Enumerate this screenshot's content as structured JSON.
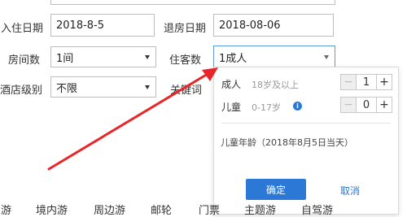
{
  "form": {
    "checkin": {
      "label": "入住日期",
      "value": "2018-8-5"
    },
    "checkout": {
      "label": "退房日期",
      "value": "2018-08-06"
    },
    "rooms": {
      "label": "房间数",
      "value": "1间"
    },
    "guests": {
      "label": "住客数",
      "value": "1成人"
    },
    "hotel_level": {
      "label": "酒店级别",
      "value": "不限"
    },
    "keyword": {
      "label": "关键词"
    }
  },
  "guest_popup": {
    "adult": {
      "label": "成人",
      "desc": "18岁及以上",
      "count": "1"
    },
    "child": {
      "label": "儿童",
      "desc": "0-17岁",
      "count": "0"
    },
    "minus_symbol": "−",
    "plus_symbol": "+",
    "info_symbol": "i",
    "child_age_note": "儿童年龄（2018年8月5日当天）",
    "confirm_label": "确定",
    "cancel_label": "取消"
  },
  "nav": {
    "items": [
      "游",
      "境内游",
      "周边游",
      "邮轮",
      "门票",
      "主题游",
      "自驾游"
    ]
  },
  "colors": {
    "accent": "#2b78d6",
    "arrow": "#e8262a"
  }
}
